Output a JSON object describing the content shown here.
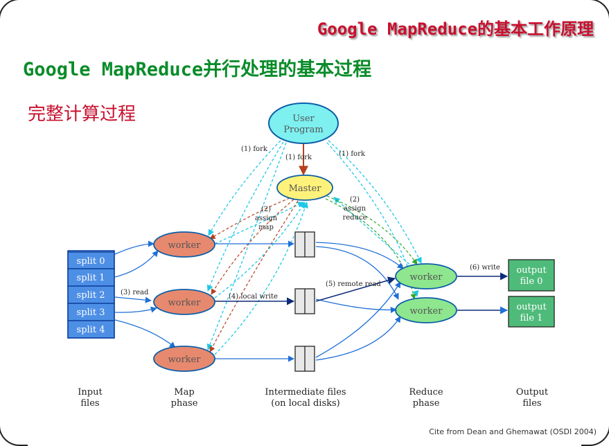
{
  "slide": {
    "top_title": "Google MapReduce的基本工作原理",
    "main_title": "Google MapReduce并行处理的基本过程",
    "subtitle": "完整计算过程",
    "citation": "Cite from Dean and Ghemawat (OSDI 2004)"
  },
  "diagram": {
    "user_program": {
      "line1": "User",
      "line2": "Program"
    },
    "master": "Master",
    "splits": [
      "split 0",
      "split 1",
      "split 2",
      "split 3",
      "split 4"
    ],
    "map_worker": "worker",
    "reduce_worker": "worker",
    "output_files": [
      {
        "line1": "output",
        "line2": "file 0"
      },
      {
        "line1": "output",
        "line2": "file 1"
      }
    ],
    "edge_labels": {
      "fork_left": "(1) fork",
      "fork_center": "(1) fork",
      "fork_right": "(1) fork",
      "assign_map": {
        "line1": "(2)",
        "line2": "assign",
        "line3": "map"
      },
      "assign_reduce": {
        "line1": "(2)",
        "line2": "assign",
        "line3": "reduce"
      },
      "read": "(3) read",
      "local_write": "(4) local write",
      "remote_read": "(5) remote read",
      "write": "(6) write"
    },
    "bottom_labels": {
      "input": {
        "line1": "Input",
        "line2": "files"
      },
      "map": {
        "line1": "Map",
        "line2": "phase"
      },
      "intermediate": {
        "line1": "Intermediate files",
        "line2": "(on local disks)"
      },
      "reduce": {
        "line1": "Reduce",
        "line2": "phase"
      },
      "output": {
        "line1": "Output",
        "line2": "files"
      }
    },
    "colors": {
      "user_program": "#7ef0f0",
      "master": "#fff27a",
      "split_box": "#4e8fe6",
      "map_worker": "#e7896f",
      "reduce_worker": "#8ee68e",
      "output_file": "#4fbb7a",
      "fork_arrow": "#1ec8e8",
      "assign_map_arrow": "#b5401e",
      "assign_reduce_arrow": "#2ea82e",
      "data_arrow": "#1f6fd6"
    }
  }
}
